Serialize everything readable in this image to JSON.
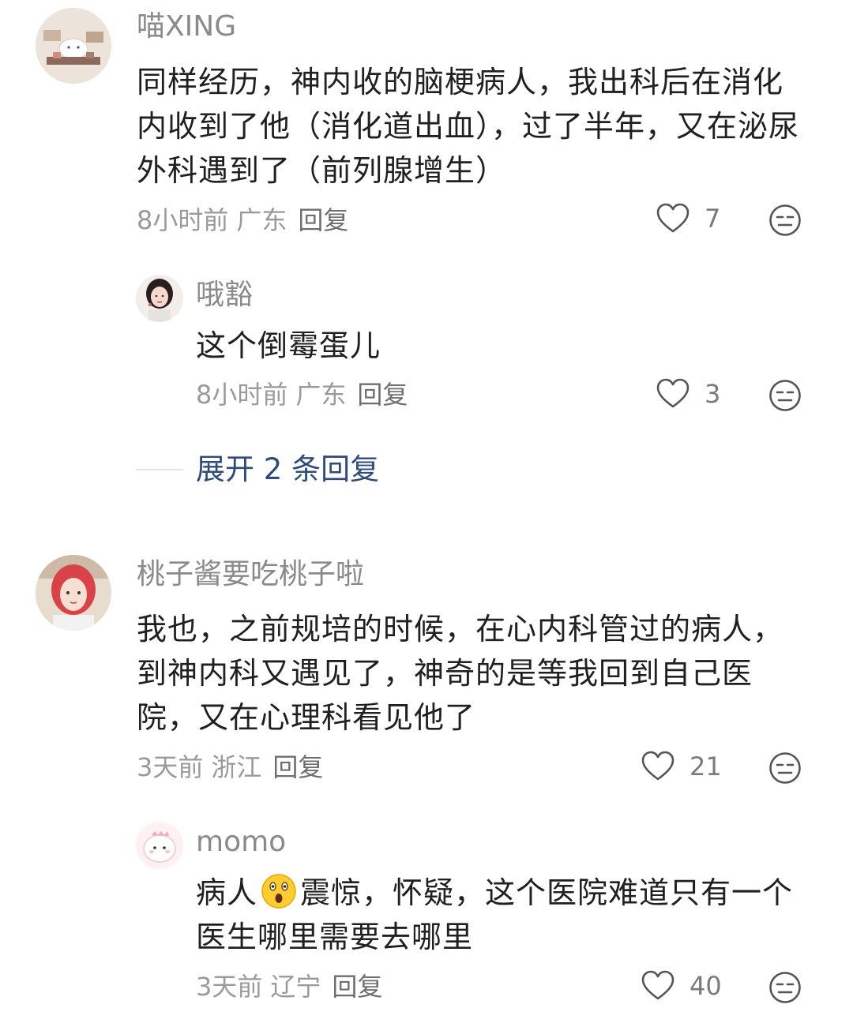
{
  "comments": [
    {
      "username": "喵XING",
      "text": "同样经历，神内收的脑梗病人，我出科后在消化内收到了他（消化道出血），过了半年，又在泌尿外科遇到了（前列腺增生）",
      "time": "8小时前",
      "location": "广东",
      "reply_label": "回复",
      "likes": "7"
    },
    {
      "username": "哦豁",
      "text": "这个倒霉蛋儿",
      "time": "8小时前",
      "location": "广东",
      "reply_label": "回复",
      "likes": "3"
    },
    {
      "username": "桃子酱要吃桃子啦",
      "text": "我也，之前规培的时候，在心内科管过的病人，到神内科又遇见了，神奇的是等我回到自己医院，又在心理科看见他了",
      "time": "3天前",
      "location": "浙江",
      "reply_label": "回复",
      "likes": "21"
    },
    {
      "username": "momo",
      "text_before_emoji": "病人",
      "text_after_emoji": "震惊，怀疑，这个医院难道只有一个医生哪里需要去哪里",
      "time": "3天前",
      "location": "辽宁",
      "reply_label": "回复",
      "likes": "40"
    }
  ],
  "expand_replies": "展开 2 条回复",
  "icons": {
    "like": "heart-outline-icon",
    "react": "neutral-face-icon",
    "inline_emoji": "astonished-face-emoji"
  },
  "colors": {
    "link": "#2f4b7a",
    "meta": "#9a9a9a",
    "username": "#8a8a8a"
  }
}
